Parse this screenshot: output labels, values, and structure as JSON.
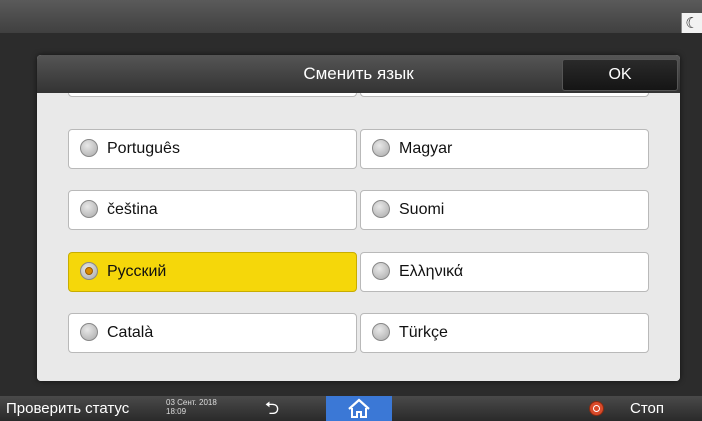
{
  "topbar": {
    "night_mode_icon": "moon-icon"
  },
  "dialog": {
    "title": "Сменить язык",
    "ok_label": "OK",
    "languages": [
      {
        "label": "Português",
        "selected": false
      },
      {
        "label": "Magyar",
        "selected": false
      },
      {
        "label": "čeština",
        "selected": false
      },
      {
        "label": "Suomi",
        "selected": false
      },
      {
        "label": "Русский",
        "selected": true
      },
      {
        "label": "Ελληνικά",
        "selected": false
      },
      {
        "label": "Català",
        "selected": false
      },
      {
        "label": "Türkçe",
        "selected": false
      }
    ]
  },
  "bottombar": {
    "status_label": "Проверить статус",
    "date": "03 Сент. 2018",
    "time": "18:09",
    "back_icon": "back-arrow-icon",
    "home_icon": "home-icon",
    "stop_icon": "stop-icon",
    "stop_label": "Стоп"
  },
  "colors": {
    "selected_bg": "#f5d70a",
    "home_bg": "#3b78d6",
    "stop_icon": "#d94a2a"
  }
}
